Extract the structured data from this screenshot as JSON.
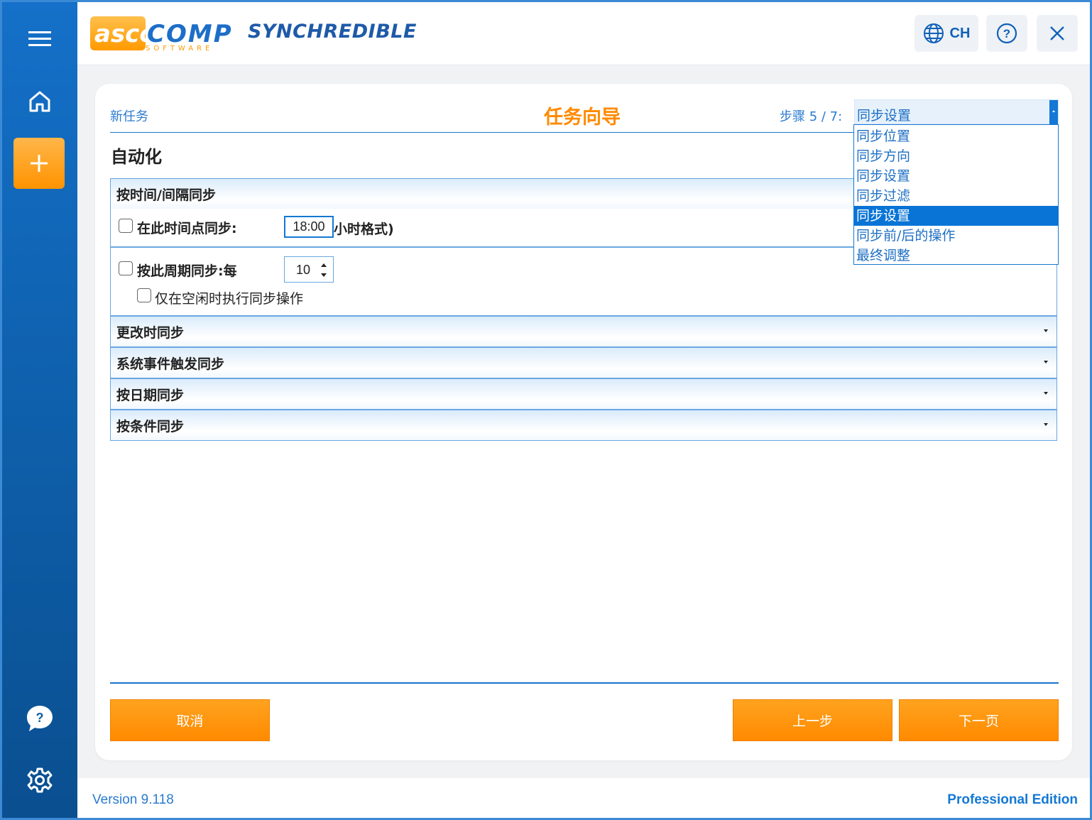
{
  "app": {
    "logo_text": "ascomp",
    "logo_sub": "SOFTWARE",
    "product_name": "SYNCHREDIBLE",
    "language": "CH"
  },
  "sidebar": {
    "menu_icon": "hamburger-icon",
    "home_icon": "home-icon",
    "add_icon": "plus-icon",
    "help_icon": "help-bubble-icon",
    "settings_icon": "gear-icon"
  },
  "wizard": {
    "task_name": "新任务",
    "title": "任务向导",
    "step_label": "步骤 5 / 7:",
    "step_selected": "同步设置",
    "section_title": "自动化",
    "steps": [
      "同步位置",
      "同步方向",
      "同步设置",
      "同步过滤",
      "同步设置",
      "同步前/后的操作",
      "最终调整"
    ],
    "selected_index": 4
  },
  "panels": {
    "time_interval": {
      "header": "按时间/间隔同步",
      "at_time_label": "在此时间点同步:",
      "time_value": "18:00",
      "time_format_suffix": "小时格式)",
      "at_time_checked": false,
      "period_label": "按此周期同步:每",
      "period_value": "10",
      "period_checked": false,
      "idle_label": "仅在空闲时执行同步操作",
      "idle_checked": false
    },
    "on_change": {
      "header": "更改时同步"
    },
    "system_event": {
      "header": "系统事件触发同步"
    },
    "by_date": {
      "header": "按日期同步"
    },
    "by_condition": {
      "header": "按条件同步"
    }
  },
  "buttons": {
    "cancel": "取消",
    "back": "上一步",
    "next": "下一页"
  },
  "status": {
    "version": "Version 9.118",
    "edition": "Professional Edition"
  },
  "colors": {
    "accent_orange": "#ff8a00",
    "sidebar_blue": "#1470c8",
    "link_blue": "#2a7bd0"
  }
}
